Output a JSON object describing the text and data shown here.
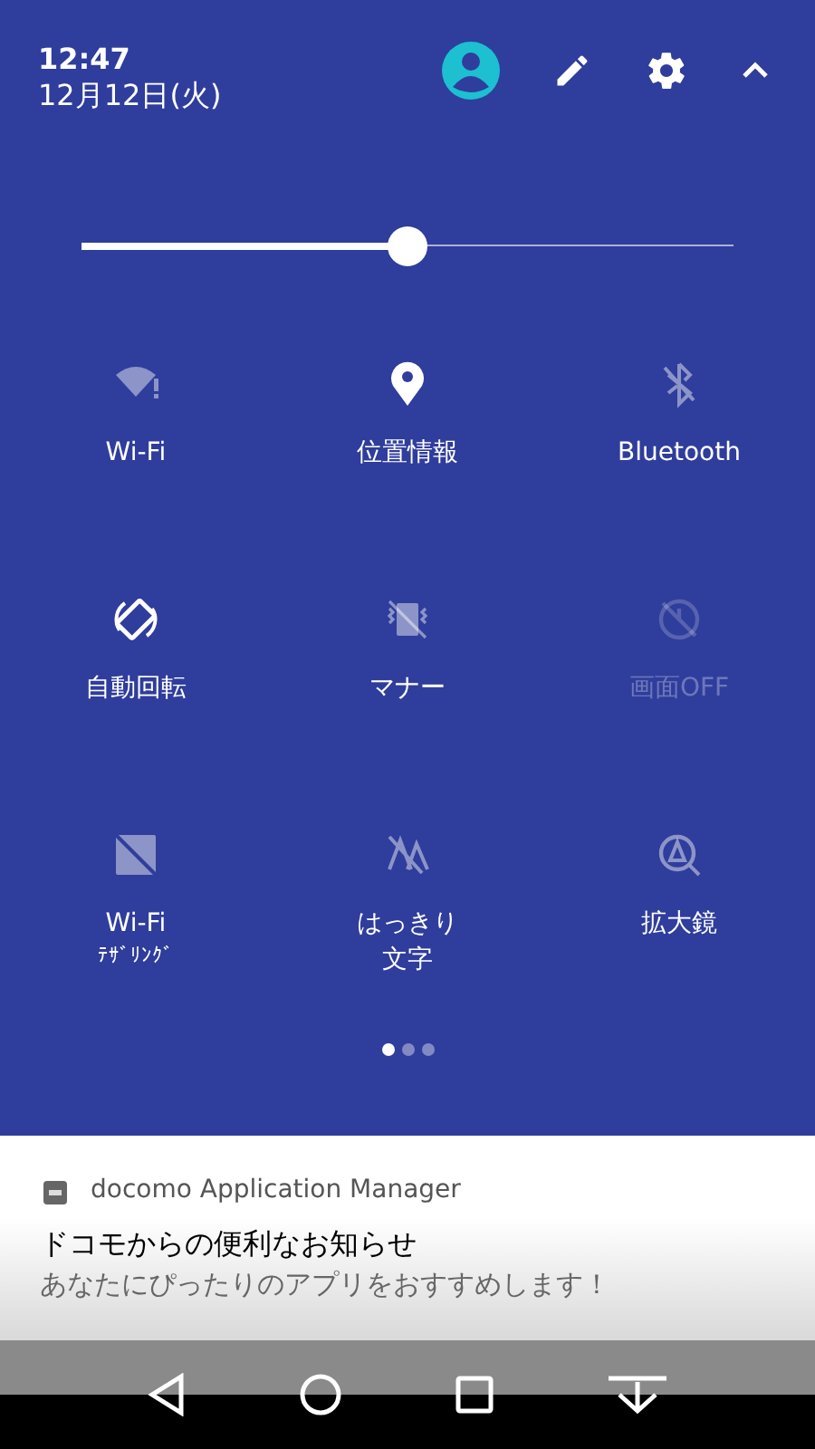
{
  "header": {
    "time": "12:47",
    "date": "12月12日(火)"
  },
  "brightness": {
    "level": 0.5
  },
  "tiles": [
    {
      "kind": "wifi",
      "label": "Wi-Fi",
      "on": false,
      "disabled": false
    },
    {
      "kind": "location",
      "label": "位置情報",
      "on": true,
      "disabled": false
    },
    {
      "kind": "bluetooth",
      "label": "Bluetooth",
      "on": false,
      "disabled": false
    },
    {
      "kind": "rotate",
      "label": "自動回転",
      "on": true,
      "disabled": false
    },
    {
      "kind": "manner",
      "label": "マナー",
      "on": false,
      "disabled": false
    },
    {
      "kind": "screen-off",
      "label": "画面OFF",
      "on": false,
      "disabled": true
    },
    {
      "kind": "tethering",
      "label": "Wi-Fi",
      "sublabel": "ﾃｻﾞﾘﾝｸﾞ",
      "on": false,
      "disabled": false
    },
    {
      "kind": "text",
      "label": "はっきり",
      "sublabel": "文字",
      "on": false,
      "disabled": false
    },
    {
      "kind": "magnifier",
      "label": "拡大鏡",
      "on": false,
      "disabled": false
    }
  ],
  "pages": [
    {
      "selected": true
    },
    {
      "selected": false
    },
    {
      "selected": false
    }
  ],
  "notification": {
    "app": "docomo Application Manager",
    "title": "ドコモからの便利なお知らせ",
    "text": "あなたにぴったりのアプリをおすすめします！"
  }
}
